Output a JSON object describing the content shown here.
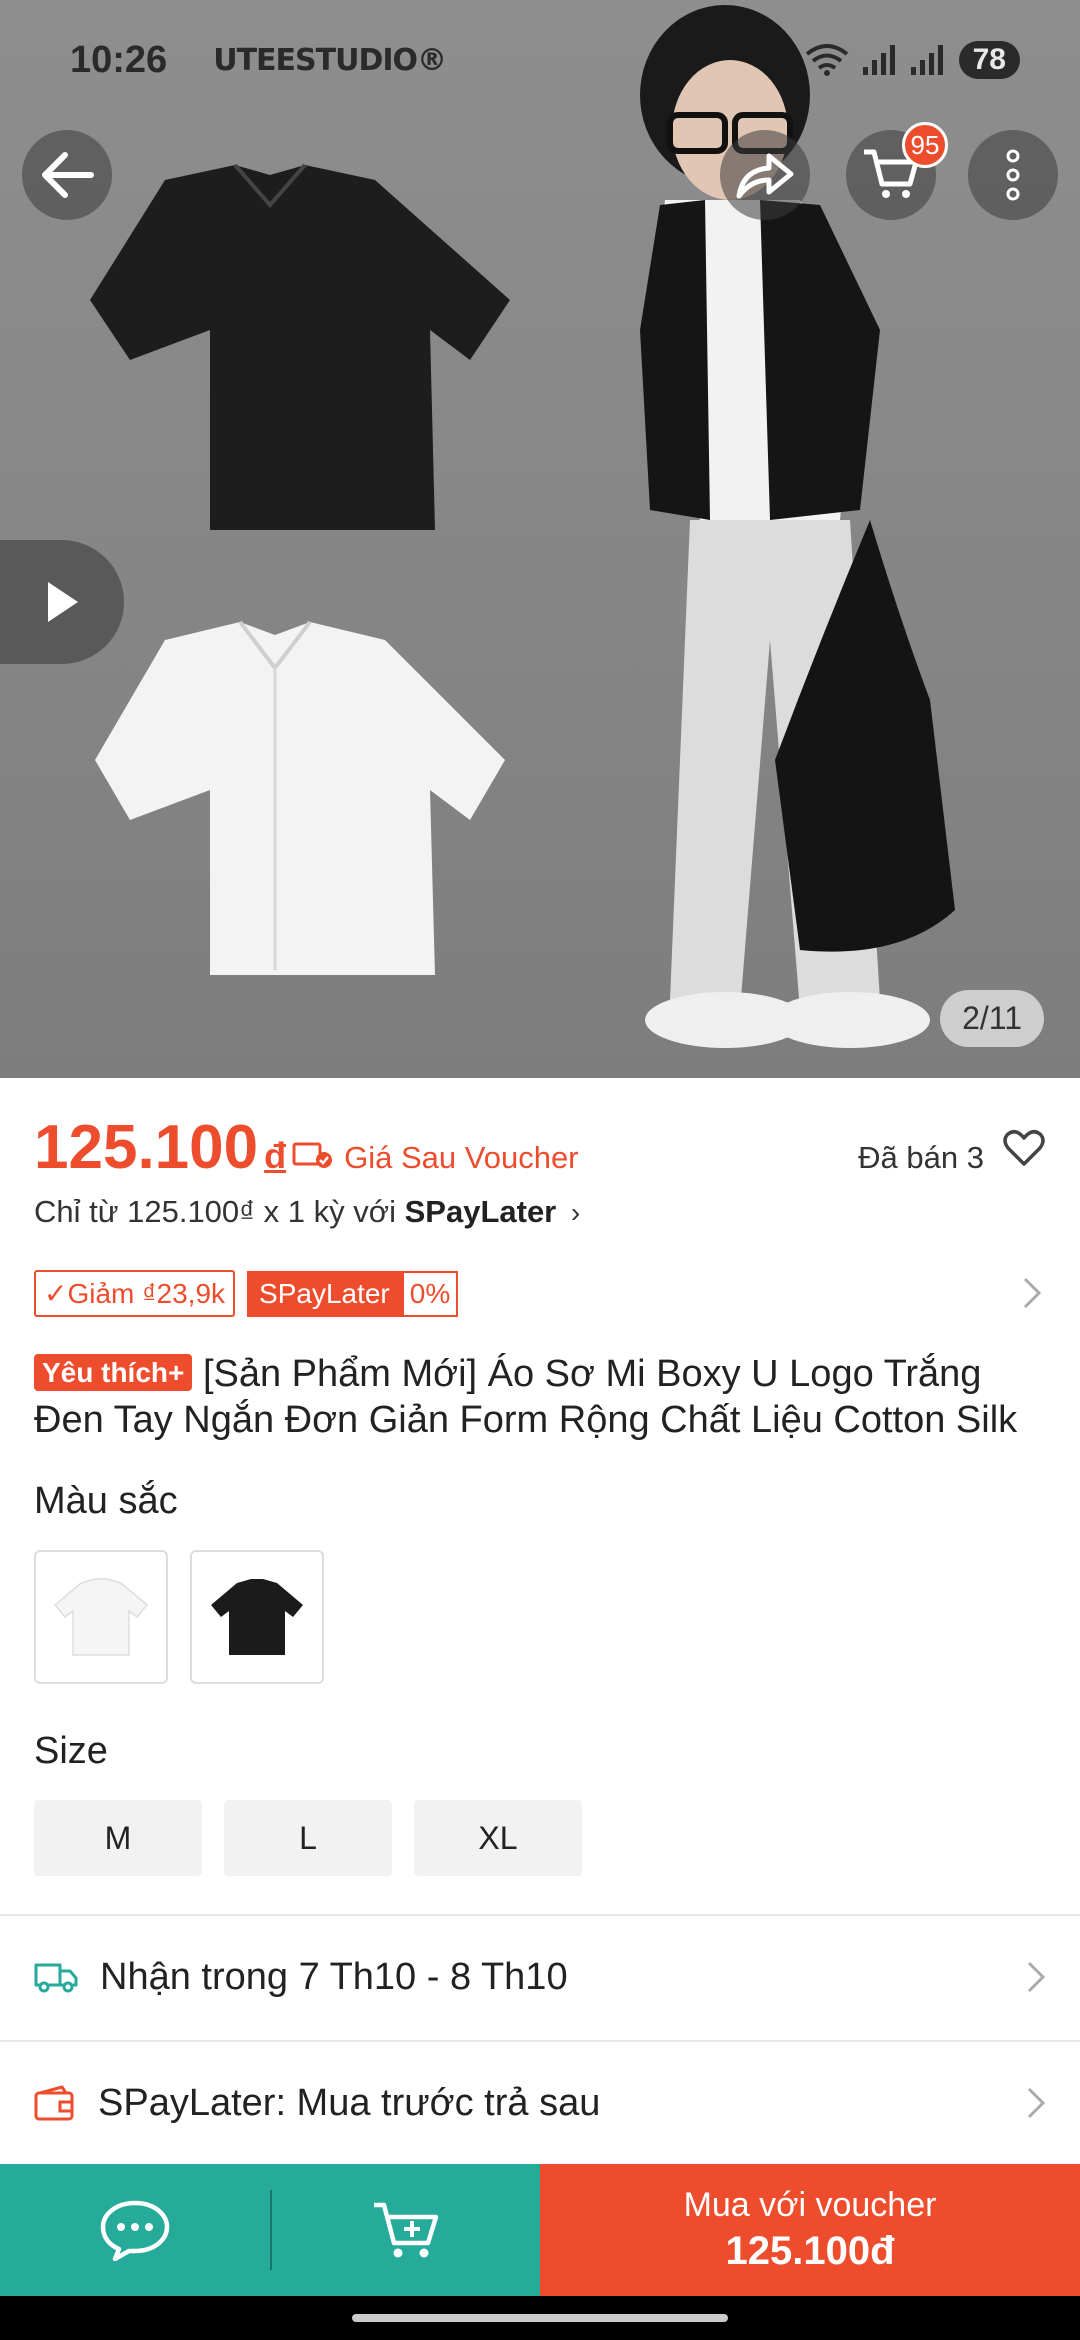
{
  "status_bar": {
    "time": "10:26",
    "brand": "UTEESTUDIO®",
    "battery": "78"
  },
  "hero": {
    "cart_count": "95",
    "page_indicator": "2/11"
  },
  "price": {
    "amount": "125.100",
    "currency": "đ",
    "voucher_label": "Giá Sau Voucher",
    "sold": "Đã bán 3",
    "paylater_prefix": "Chỉ từ 125.100₫ x 1 kỳ với",
    "paylater_brand": "SPayLater"
  },
  "badges": {
    "discount": "Giảm ₫23,9k",
    "spaylater": "SPayLater",
    "percent": "0%"
  },
  "product": {
    "fav_tag": "Yêu thích+",
    "title": "[Sản Phẩm Mới] Áo Sơ Mi Boxy U Logo Trắng Đen Tay Ngắn Đơn Giản Form Rộng Chất Liệu Cotton Silk"
  },
  "variants": {
    "color_label": "Màu sắc",
    "size_label": "Size",
    "sizes": [
      "M",
      "L",
      "XL"
    ]
  },
  "info_rows": {
    "delivery": "Nhận trong 7 Th10 - 8 Th10",
    "spaylater": "SPayLater: Mua trước trả sau"
  },
  "bottom_bar": {
    "buy_line1": "Mua với voucher",
    "buy_line2": "125.100đ"
  },
  "colors": {
    "accent": "#ee4d2d",
    "teal": "#26aa99"
  }
}
